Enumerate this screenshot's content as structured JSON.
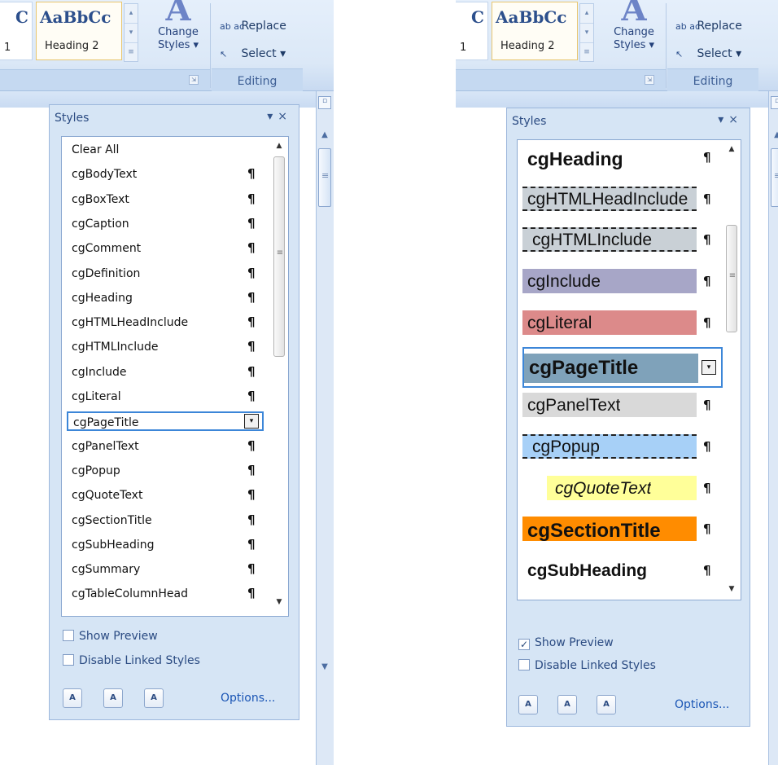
{
  "ribbon": {
    "gallery_sample": "AaBbCc",
    "gallery_prev_sample": "C",
    "gallery_prev_label": "1",
    "heading2_label": "Heading 2",
    "change_styles_line1": "Change",
    "change_styles_line2": "Styles ▾",
    "replace_label": "Replace",
    "replace_icon": "ab ac",
    "select_label": "Select ▾",
    "select_icon": "↖",
    "editing_label": "Editing",
    "launcher_icon": "⇲"
  },
  "left_pane": {
    "title": "Styles",
    "controls": "▾ ×",
    "items": [
      "Clear All",
      "cgBodyText",
      "cgBoxText",
      "cgCaption",
      "cgComment",
      "cgDefinition",
      "cgHeading",
      "cgHTMLHeadInclude",
      "cgHTMLInclude",
      "cgInclude",
      "cgLiteral",
      "cgPageTitle",
      "cgPanelText",
      "cgPopup",
      "cgQuoteText",
      "cgSectionTitle",
      "cgSubHeading",
      "cgSummary",
      "cgTableColumnHead"
    ],
    "selected": "cgPageTitle",
    "pilcrow": "¶",
    "dropdown": "▾",
    "show_preview_label": "Show Preview",
    "show_preview_checked": false,
    "disable_linked_label": "Disable Linked Styles",
    "disable_linked_checked": false,
    "options_label": "Options..."
  },
  "right_pane": {
    "title": "Styles",
    "controls": "▾ ×",
    "items": [
      {
        "name": "cgHeading",
        "bg": "#ffffff"
      },
      {
        "name": "cgHTMLHeadInclude",
        "bg": "#c9d0d6"
      },
      {
        "name": "cgHTMLInclude",
        "bg": "#c9d0d6"
      },
      {
        "name": "cgInclude",
        "bg": "#a7a6c7"
      },
      {
        "name": "cgLiteral",
        "bg": "#dc8a8a"
      },
      {
        "name": "cgPageTitle",
        "bg": "#7fa2ba"
      },
      {
        "name": "cgPanelText",
        "bg": "#d9d9d9"
      },
      {
        "name": "cgPopup",
        "bg": "#a7d0f7"
      },
      {
        "name": "cgQuoteText",
        "bg": "#ffff99"
      },
      {
        "name": "cgSectionTitle",
        "bg": "#ff8c00"
      },
      {
        "name": "cgSubHeading",
        "bg": "#ffffff"
      }
    ],
    "selected": "cgPageTitle",
    "pilcrow": "¶",
    "show_preview_label": "Show Preview",
    "show_preview_checked": true,
    "disable_linked_label": "Disable Linked Styles",
    "disable_linked_checked": false,
    "options_label": "Options..."
  },
  "buttons": {
    "new_style_icon": "A",
    "inspector_icon": "A",
    "manage_icon": "A"
  }
}
